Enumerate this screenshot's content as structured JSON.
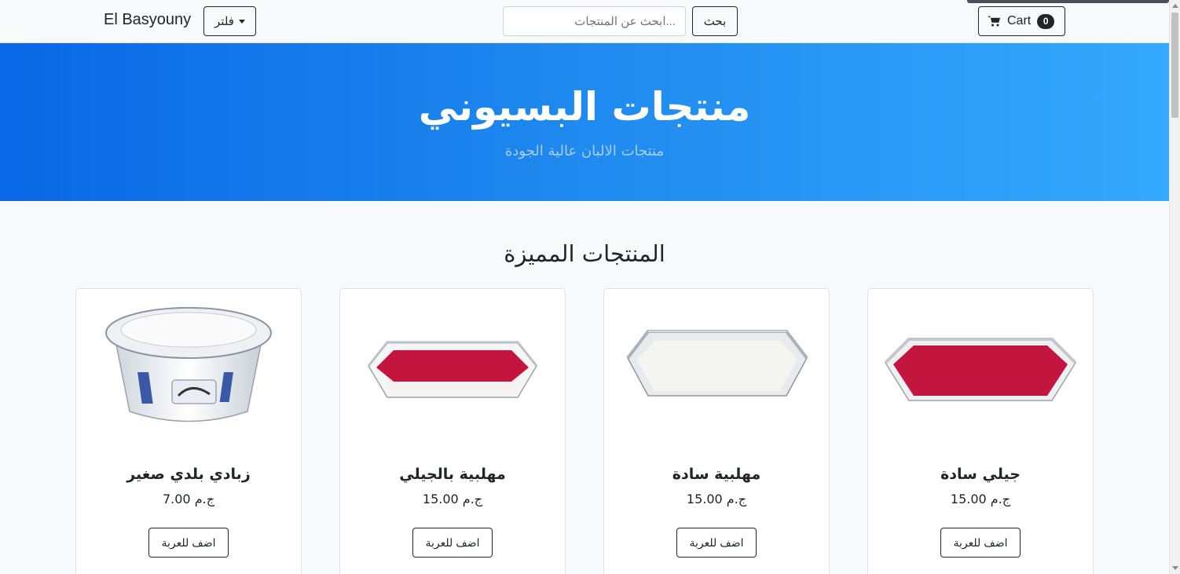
{
  "navbar": {
    "brand": "El Basyouny",
    "filter_label": "فلتر",
    "search_placeholder": "...ابحث عن المنتجات",
    "search_button": "بحث",
    "cart_label": "Cart",
    "cart_count": "0"
  },
  "hero": {
    "title": "منتجات البسيوني",
    "subtitle": "منتجات الالبان عالية الجودة"
  },
  "featured": {
    "heading": "المنتجات المميزة",
    "products": [
      {
        "name": "زبادي بلدي صغير",
        "price": "ج.م 7.00",
        "button": "اضف للعربة",
        "image": "yogurt-cup"
      },
      {
        "name": "مهلبية بالجيلي",
        "price": "ج.م 15.00",
        "button": "اضف للعربة",
        "image": "muhallabia-jelly-dish"
      },
      {
        "name": "مهلبية سادة",
        "price": "ج.م 15.00",
        "button": "اضف للعربة",
        "image": "muhallabia-plain-dish"
      },
      {
        "name": "جيلي سادة",
        "price": "ج.م 15.00",
        "button": "اضف للعربة",
        "image": "jelly-dish"
      }
    ]
  },
  "colors": {
    "hero_gradient_start": "#0a67e6",
    "hero_gradient_end": "#35a9fd",
    "jelly_red": "#c4153e",
    "dark": "#212529"
  }
}
